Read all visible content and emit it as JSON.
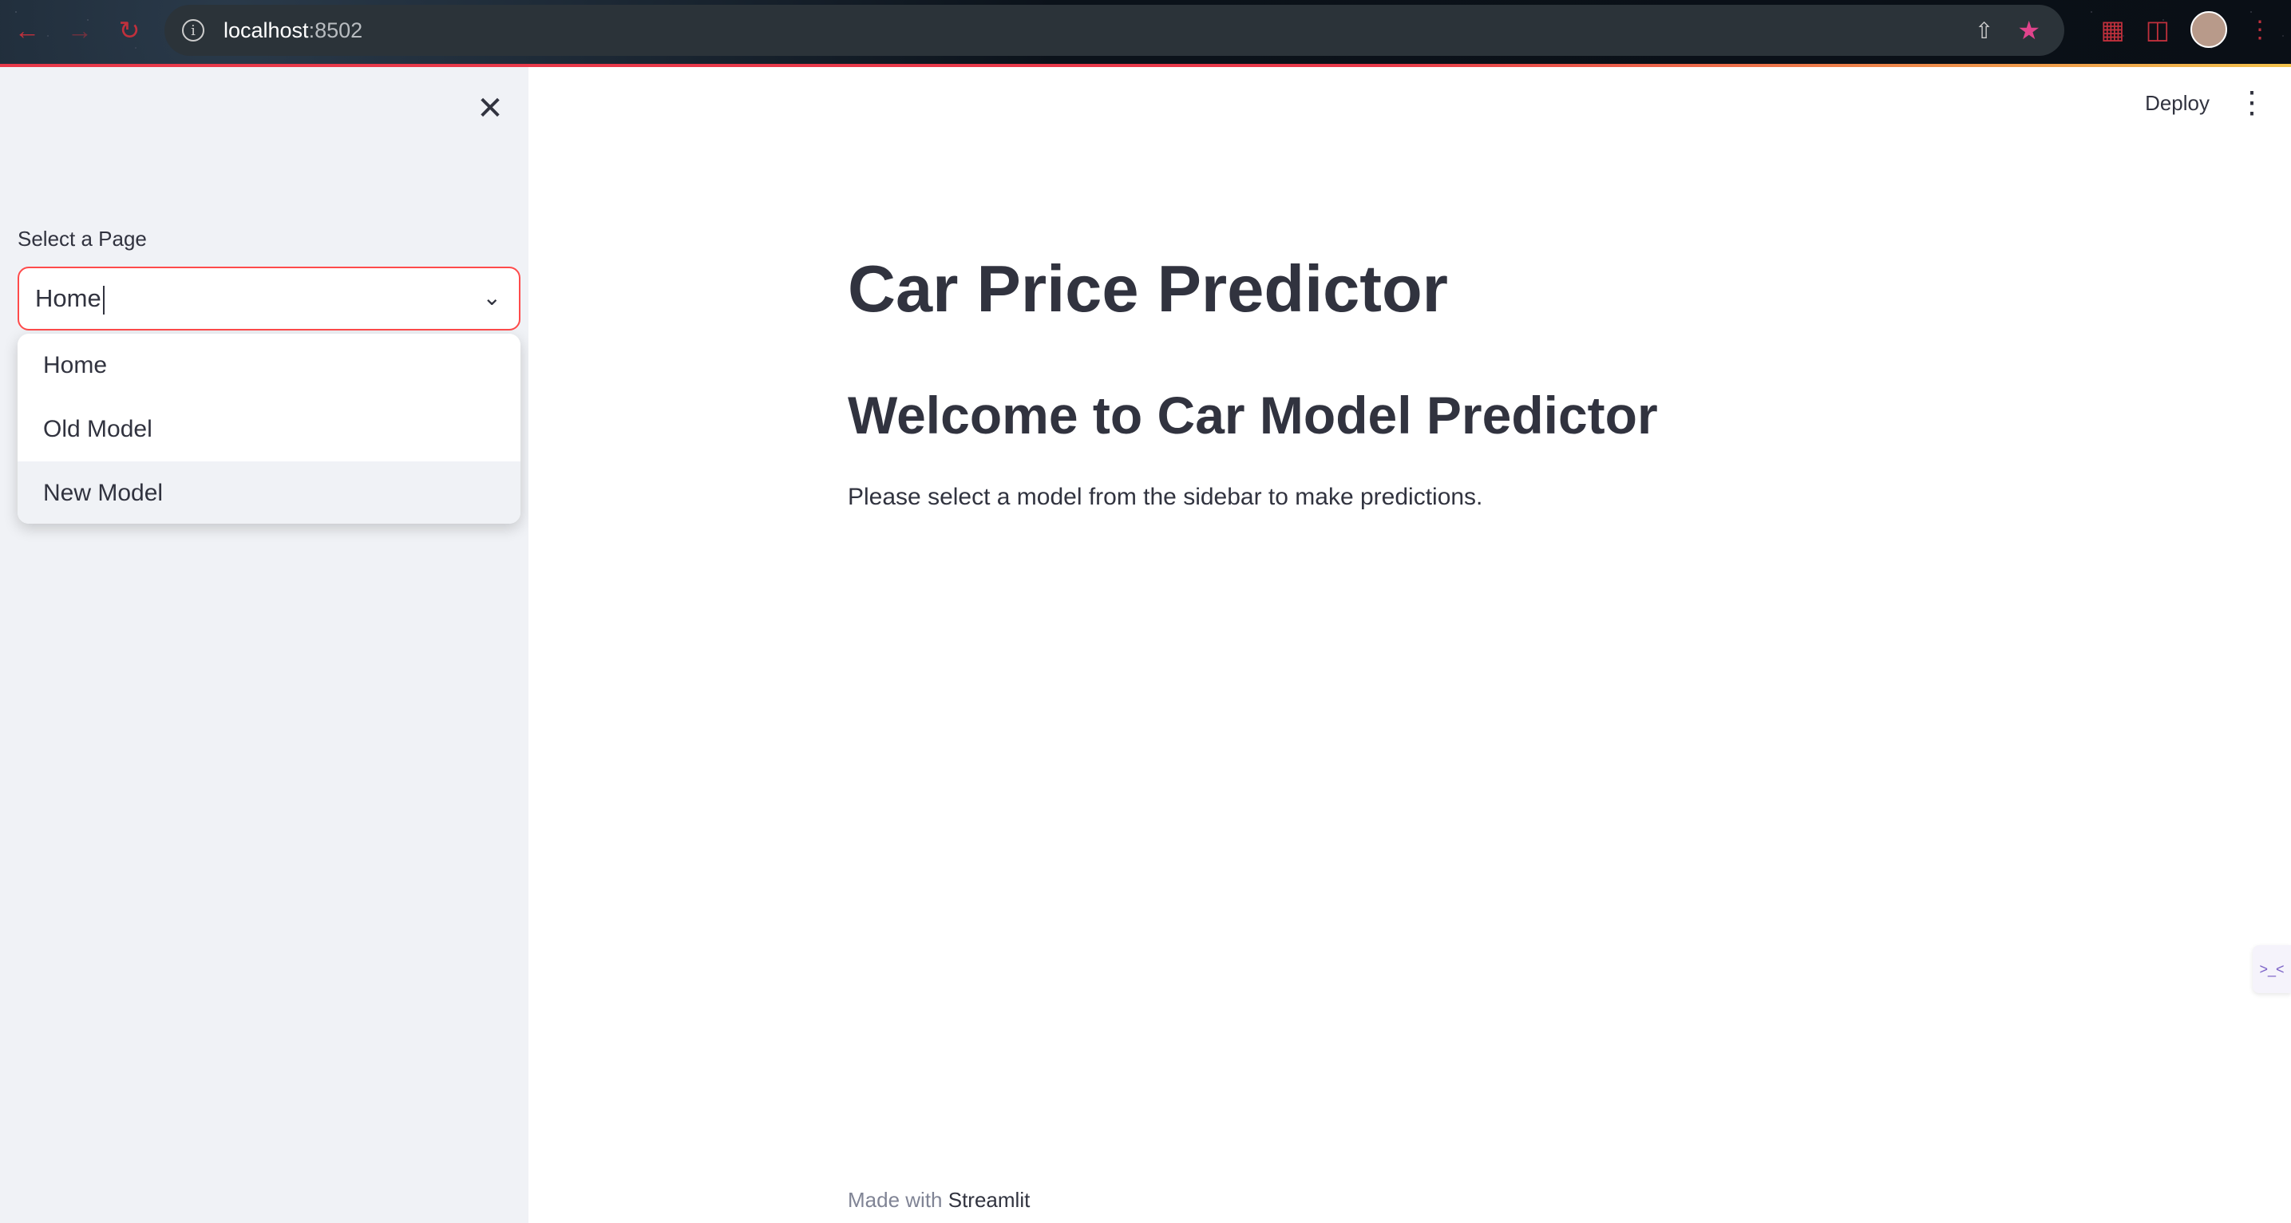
{
  "browser": {
    "url_host": "localhost",
    "url_port": ":8502",
    "icons": [
      "back-arrow-icon",
      "forward-arrow-icon",
      "reload-icon",
      "info-icon",
      "share-icon",
      "star-icon",
      "extensions-icon",
      "sidebar-icon",
      "profile-avatar",
      "browser-menu-icon"
    ]
  },
  "sidebar": {
    "select_label": "Select a Page",
    "select_value": "Home",
    "options": [
      "Home",
      "Old Model",
      "New Model"
    ],
    "highlighted_option": "New Model"
  },
  "header": {
    "deploy_label": "Deploy"
  },
  "main": {
    "title": "Car Price Predictor",
    "subtitle": "Welcome to Car Model Predictor",
    "text": "Please select a model from the sidebar to make predictions."
  },
  "footer": {
    "prefix": "Made with",
    "brand": "Streamlit"
  },
  "colors": {
    "accent": "#ff4b4b",
    "sidebar_bg": "#f0f2f6",
    "text": "#31333F"
  }
}
